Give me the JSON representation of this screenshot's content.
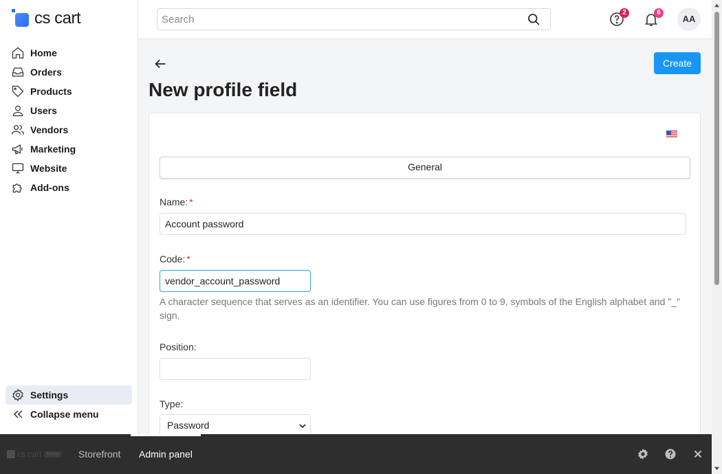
{
  "brand": {
    "name": "cs cart"
  },
  "sidebar": {
    "items": [
      {
        "label": "Home",
        "icon": "home-icon"
      },
      {
        "label": "Orders",
        "icon": "inbox-icon"
      },
      {
        "label": "Products",
        "icon": "tag-icon"
      },
      {
        "label": "Users",
        "icon": "user-icon"
      },
      {
        "label": "Vendors",
        "icon": "users-icon"
      },
      {
        "label": "Marketing",
        "icon": "megaphone-icon"
      },
      {
        "label": "Website",
        "icon": "monitor-icon"
      },
      {
        "label": "Add-ons",
        "icon": "puzzle-icon"
      }
    ],
    "settings_label": "Settings",
    "collapse_label": "Collapse menu"
  },
  "header": {
    "search_placeholder": "Search",
    "help_badge": "2",
    "notifications_badge": "6",
    "avatar_initials": "AA"
  },
  "page": {
    "title": "New profile field",
    "create_label": "Create"
  },
  "form": {
    "language_flag": "flag-us-icon",
    "tab_general": "General",
    "name_label": "Name:",
    "name_value": "Account password",
    "code_label": "Code:",
    "code_value": "vendor_account_password",
    "code_help": "A character sequence that serves as an identifier. You can use figures from 0 to 9, symbols of the English alphabet and \"_\" sign.",
    "required_mark": "*",
    "position_label": "Position:",
    "position_value": "",
    "type_label": "Type:",
    "type_value": "Password"
  },
  "bottombar": {
    "logo_text": "cs cart",
    "logo_badge": "Demo",
    "storefront_label": "Storefront",
    "admin_label": "Admin panel"
  },
  "colors": {
    "accent": "#1a96f2",
    "badge_red": "#d6215b",
    "badge_pink": "#ec3b83",
    "required": "#e0243a",
    "bottombar_bg": "#2e2e2e"
  }
}
